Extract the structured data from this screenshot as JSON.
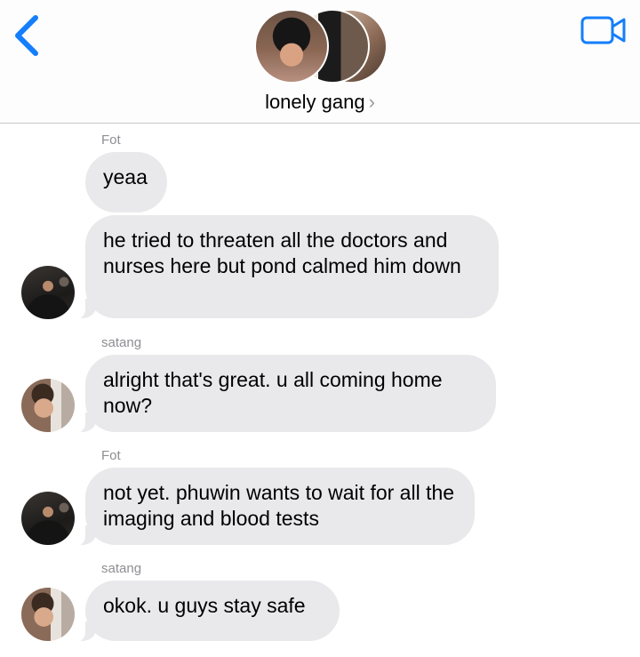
{
  "header": {
    "group_name": "lonely gang",
    "chevron": "›",
    "back_icon": "chevron-left-icon",
    "video_icon": "video-camera-icon",
    "accent_color": "#147efb"
  },
  "messages": [
    {
      "sender": "Fot",
      "text": "yeaa"
    },
    {
      "sender": "",
      "text": "he tried to threaten all the doctors and nurses here but pond calmed him down"
    },
    {
      "sender": "satang",
      "text": "alright that's great. u all coming home now?"
    },
    {
      "sender": "Fot",
      "text": "not yet. phuwin wants to wait for all the imaging and blood tests"
    },
    {
      "sender": "satang",
      "text": "okok. u guys stay safe"
    }
  ],
  "colors": {
    "bubble": "#e9e9eb",
    "sender_label": "#8e8e93"
  }
}
